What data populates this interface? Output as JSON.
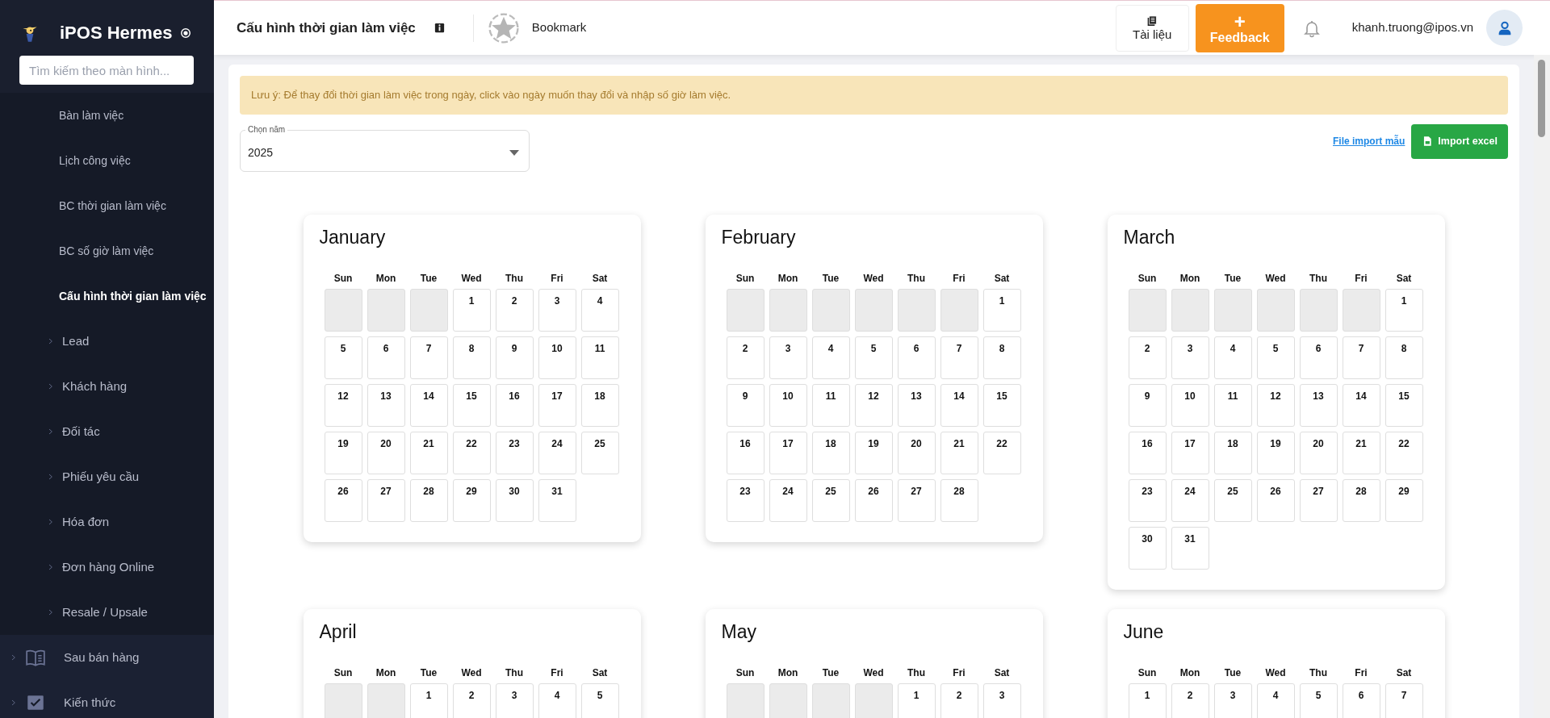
{
  "sidebar": {
    "brand": "iPOS Hermes",
    "search": {
      "placeholder": "Tìm kiếm theo màn hình..."
    },
    "items": [
      {
        "kind": "sub",
        "label": "Bàn làm việc",
        "selected": false
      },
      {
        "kind": "sub",
        "label": "Lịch công việc",
        "selected": false
      },
      {
        "kind": "sub",
        "label": "BC thời gian làm việc",
        "selected": false
      },
      {
        "kind": "sub",
        "label": "BC số giờ làm việc",
        "selected": false
      },
      {
        "kind": "sub",
        "label": "Cấu hình thời gian làm việc",
        "selected": true
      },
      {
        "kind": "group",
        "label": "Lead",
        "expanded": false
      },
      {
        "kind": "group",
        "label": "Khách hàng",
        "expanded": false
      },
      {
        "kind": "group",
        "label": "Đối tác",
        "expanded": false
      },
      {
        "kind": "group",
        "label": "Phiếu yêu cầu",
        "expanded": false
      },
      {
        "kind": "group",
        "label": "Hóa đơn",
        "expanded": false
      },
      {
        "kind": "group",
        "label": "Đơn hàng Online",
        "expanded": false
      },
      {
        "kind": "group",
        "label": "Resale / Upsale",
        "expanded": false
      },
      {
        "kind": "section",
        "label": "Sau bán hàng",
        "expanded": false
      },
      {
        "kind": "section",
        "label": "Kiến thức",
        "expanded": false
      }
    ]
  },
  "header": {
    "title": "Cấu hình thời gian làm việc",
    "bookmark": "Bookmark",
    "docs_button": "Tài liệu",
    "feedback_button": {
      "symbol": "+",
      "label": "Feedback"
    },
    "user_email": "khanh.truong@ipos.vn"
  },
  "content": {
    "notice": "Lưu ý: Để thay đổi thời gian làm việc trong ngày, click vào ngày muốn thay đổi và nhập số giờ làm việc.",
    "year_select": {
      "label": "Chọn năm",
      "value": "2025"
    },
    "template_link": "File import mẫu",
    "import_button": "Import excel",
    "months": [
      {
        "name": "January",
        "weekdays": [
          "Sun",
          "Mon",
          "Tue",
          "Wed",
          "Thu",
          "Fri",
          "Sat"
        ],
        "cells": [
          {
            "kind": "pad"
          },
          {
            "kind": "pad"
          },
          {
            "kind": "pad"
          },
          {
            "kind": "day",
            "label": "1"
          },
          {
            "kind": "day",
            "label": "2"
          },
          {
            "kind": "day",
            "label": "3"
          },
          {
            "kind": "day",
            "label": "4"
          },
          {
            "kind": "day",
            "label": "5"
          },
          {
            "kind": "day",
            "label": "6"
          },
          {
            "kind": "day",
            "label": "7"
          },
          {
            "kind": "day",
            "label": "8"
          },
          {
            "kind": "day",
            "label": "9"
          },
          {
            "kind": "day",
            "label": "10"
          },
          {
            "kind": "day",
            "label": "11"
          },
          {
            "kind": "day",
            "label": "12"
          },
          {
            "kind": "day",
            "label": "13"
          },
          {
            "kind": "day",
            "label": "14"
          },
          {
            "kind": "day",
            "label": "15"
          },
          {
            "kind": "day",
            "label": "16"
          },
          {
            "kind": "day",
            "label": "17"
          },
          {
            "kind": "day",
            "label": "18"
          },
          {
            "kind": "day",
            "label": "19"
          },
          {
            "kind": "day",
            "label": "20"
          },
          {
            "kind": "day",
            "label": "21"
          },
          {
            "kind": "day",
            "label": "22"
          },
          {
            "kind": "day",
            "label": "23"
          },
          {
            "kind": "day",
            "label": "24"
          },
          {
            "kind": "day",
            "label": "25"
          },
          {
            "kind": "day",
            "label": "26"
          },
          {
            "kind": "day",
            "label": "27"
          },
          {
            "kind": "day",
            "label": "28"
          },
          {
            "kind": "day",
            "label": "29"
          },
          {
            "kind": "day",
            "label": "30"
          },
          {
            "kind": "day",
            "label": "31"
          }
        ]
      },
      {
        "name": "February",
        "weekdays": [
          "Sun",
          "Mon",
          "Tue",
          "Wed",
          "Thu",
          "Fri",
          "Sat"
        ],
        "cells": [
          {
            "kind": "pad"
          },
          {
            "kind": "pad"
          },
          {
            "kind": "pad"
          },
          {
            "kind": "pad"
          },
          {
            "kind": "pad"
          },
          {
            "kind": "pad"
          },
          {
            "kind": "day",
            "label": "1"
          },
          {
            "kind": "day",
            "label": "2"
          },
          {
            "kind": "day",
            "label": "3"
          },
          {
            "kind": "day",
            "label": "4"
          },
          {
            "kind": "day",
            "label": "5"
          },
          {
            "kind": "day",
            "label": "6"
          },
          {
            "kind": "day",
            "label": "7"
          },
          {
            "kind": "day",
            "label": "8"
          },
          {
            "kind": "day",
            "label": "9"
          },
          {
            "kind": "day",
            "label": "10"
          },
          {
            "kind": "day",
            "label": "11"
          },
          {
            "kind": "day",
            "label": "12"
          },
          {
            "kind": "day",
            "label": "13"
          },
          {
            "kind": "day",
            "label": "14"
          },
          {
            "kind": "day",
            "label": "15"
          },
          {
            "kind": "day",
            "label": "16"
          },
          {
            "kind": "day",
            "label": "17"
          },
          {
            "kind": "day",
            "label": "18"
          },
          {
            "kind": "day",
            "label": "19"
          },
          {
            "kind": "day",
            "label": "20"
          },
          {
            "kind": "day",
            "label": "21"
          },
          {
            "kind": "day",
            "label": "22"
          },
          {
            "kind": "day",
            "label": "23"
          },
          {
            "kind": "day",
            "label": "24"
          },
          {
            "kind": "day",
            "label": "25"
          },
          {
            "kind": "day",
            "label": "26"
          },
          {
            "kind": "day",
            "label": "27"
          },
          {
            "kind": "day",
            "label": "28"
          }
        ]
      },
      {
        "name": "March",
        "weekdays": [
          "Sun",
          "Mon",
          "Tue",
          "Wed",
          "Thu",
          "Fri",
          "Sat"
        ],
        "cells": [
          {
            "kind": "pad"
          },
          {
            "kind": "pad"
          },
          {
            "kind": "pad"
          },
          {
            "kind": "pad"
          },
          {
            "kind": "pad"
          },
          {
            "kind": "pad"
          },
          {
            "kind": "day",
            "label": "1"
          },
          {
            "kind": "day",
            "label": "2"
          },
          {
            "kind": "day",
            "label": "3"
          },
          {
            "kind": "day",
            "label": "4"
          },
          {
            "kind": "day",
            "label": "5"
          },
          {
            "kind": "day",
            "label": "6"
          },
          {
            "kind": "day",
            "label": "7"
          },
          {
            "kind": "day",
            "label": "8"
          },
          {
            "kind": "day",
            "label": "9"
          },
          {
            "kind": "day",
            "label": "10"
          },
          {
            "kind": "day",
            "label": "11"
          },
          {
            "kind": "day",
            "label": "12"
          },
          {
            "kind": "day",
            "label": "13"
          },
          {
            "kind": "day",
            "label": "14"
          },
          {
            "kind": "day",
            "label": "15"
          },
          {
            "kind": "day",
            "label": "16"
          },
          {
            "kind": "day",
            "label": "17"
          },
          {
            "kind": "day",
            "label": "18"
          },
          {
            "kind": "day",
            "label": "19"
          },
          {
            "kind": "day",
            "label": "20"
          },
          {
            "kind": "day",
            "label": "21"
          },
          {
            "kind": "day",
            "label": "22"
          },
          {
            "kind": "day",
            "label": "23"
          },
          {
            "kind": "day",
            "label": "24"
          },
          {
            "kind": "day",
            "label": "25"
          },
          {
            "kind": "day",
            "label": "26"
          },
          {
            "kind": "day",
            "label": "27"
          },
          {
            "kind": "day",
            "label": "28"
          },
          {
            "kind": "day",
            "label": "29"
          },
          {
            "kind": "day",
            "label": "30"
          },
          {
            "kind": "day",
            "label": "31"
          }
        ]
      },
      {
        "name": "April",
        "weekdays": [
          "Sun",
          "Mon",
          "Tue",
          "Wed",
          "Thu",
          "Fri",
          "Sat"
        ],
        "cells": [
          {
            "kind": "pad"
          },
          {
            "kind": "pad"
          },
          {
            "kind": "day",
            "label": "1"
          },
          {
            "kind": "day",
            "label": "2"
          },
          {
            "kind": "day",
            "label": "3"
          },
          {
            "kind": "day",
            "label": "4"
          },
          {
            "kind": "day",
            "label": "5"
          }
        ]
      },
      {
        "name": "May",
        "weekdays": [
          "Sun",
          "Mon",
          "Tue",
          "Wed",
          "Thu",
          "Fri",
          "Sat"
        ],
        "cells": [
          {
            "kind": "pad"
          },
          {
            "kind": "pad"
          },
          {
            "kind": "pad"
          },
          {
            "kind": "pad"
          },
          {
            "kind": "day",
            "label": "1"
          },
          {
            "kind": "day",
            "label": "2"
          },
          {
            "kind": "day",
            "label": "3"
          }
        ]
      },
      {
        "name": "June",
        "weekdays": [
          "Sun",
          "Mon",
          "Tue",
          "Wed",
          "Thu",
          "Fri",
          "Sat"
        ],
        "cells": [
          {
            "kind": "day",
            "label": "1"
          },
          {
            "kind": "day",
            "label": "2"
          },
          {
            "kind": "day",
            "label": "3"
          },
          {
            "kind": "day",
            "label": "4"
          },
          {
            "kind": "day",
            "label": "5"
          },
          {
            "kind": "day",
            "label": "6"
          },
          {
            "kind": "day",
            "label": "7"
          }
        ]
      }
    ]
  }
}
